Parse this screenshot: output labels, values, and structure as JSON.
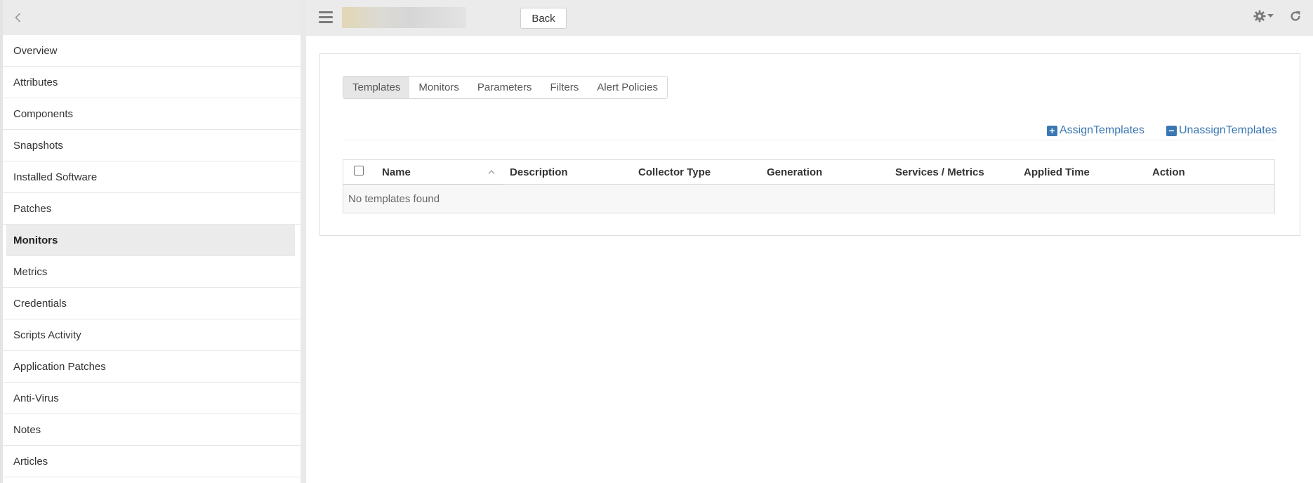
{
  "sidebar": {
    "items": [
      {
        "label": "Overview"
      },
      {
        "label": "Attributes"
      },
      {
        "label": "Components"
      },
      {
        "label": "Snapshots"
      },
      {
        "label": "Installed Software"
      },
      {
        "label": "Patches"
      },
      {
        "label": "Monitors",
        "active": true
      },
      {
        "label": "Metrics"
      },
      {
        "label": "Credentials"
      },
      {
        "label": "Scripts Activity"
      },
      {
        "label": "Application Patches"
      },
      {
        "label": "Anti-Virus"
      },
      {
        "label": "Notes"
      },
      {
        "label": "Articles"
      }
    ]
  },
  "topbar": {
    "back_label": "Back"
  },
  "tabs": [
    {
      "label": "Templates",
      "active": true
    },
    {
      "label": "Monitors"
    },
    {
      "label": "Parameters"
    },
    {
      "label": "Filters"
    },
    {
      "label": "Alert Policies"
    }
  ],
  "actions": {
    "assign_label": "AssignTemplates",
    "unassign_label": "UnassignTemplates"
  },
  "table": {
    "columns": [
      "Name",
      "Description",
      "Collector Type",
      "Generation",
      "Services / Metrics",
      "Applied Time",
      "Action"
    ],
    "empty_message": "No templates found"
  },
  "colors": {
    "link": "#3a77b3",
    "header_bg": "#ebebeb"
  }
}
